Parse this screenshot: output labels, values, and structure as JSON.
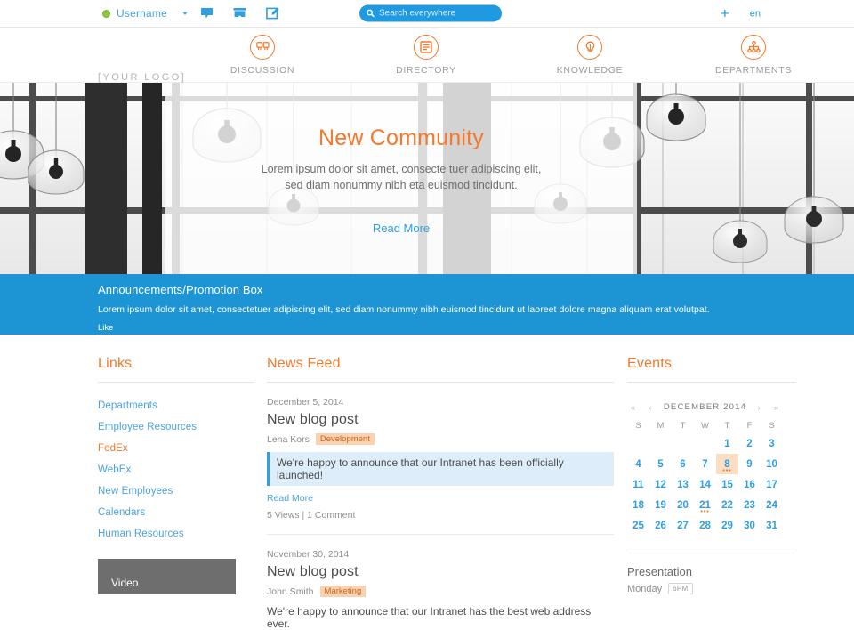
{
  "topbar": {
    "username": "Username",
    "status_icon": "status-dot-online",
    "caret_icon": "chevron-down-icon",
    "icons": [
      "chat-bubble-icon",
      "inbox-icon",
      "compose-icon"
    ],
    "search": {
      "placeholder": "Search everywhere",
      "icon": "search-icon"
    },
    "add_label": "+",
    "language": "en"
  },
  "header": {
    "logo": "[YOUR LOGO]",
    "nav": [
      {
        "label": "DISCUSSION",
        "icon": "discussion-icon"
      },
      {
        "label": "DIRECTORY",
        "icon": "directory-icon"
      },
      {
        "label": "KNOWLEDGE",
        "icon": "lightbulb-icon"
      },
      {
        "label": "DEPARTMENTS",
        "icon": "org-chart-icon"
      }
    ]
  },
  "hero": {
    "title": "New Community",
    "subtitle": "Lorem ipsum dolor sit amet, consecte tuer adipiscing elit, sed diam nonummy nibh eta euismod tincidunt.",
    "link": "Read More"
  },
  "announcement": {
    "title": "Announcements/Promotion Box",
    "body": "Lorem ipsum dolor sit amet, consectetuer adipiscing elit, sed diam nonummy nibh euismod tincidunt ut laoreet dolore magna aliquam erat volutpat.",
    "like": "Like",
    "bg_color": "#1d95d4"
  },
  "links": {
    "title": "Links",
    "items": [
      {
        "label": "Departments",
        "accent": false
      },
      {
        "label": "Employee Resources",
        "accent": false
      },
      {
        "label": "FedEx",
        "accent": true
      },
      {
        "label": "WebEx",
        "accent": false
      },
      {
        "label": "New Employees",
        "accent": false
      },
      {
        "label": "Calendars",
        "accent": false
      },
      {
        "label": "Human Resources",
        "accent": false
      }
    ],
    "video_box": "Video"
  },
  "news_feed": {
    "title": "News Feed",
    "posts": [
      {
        "date": "December 5, 2014",
        "title": "New blog post",
        "author": "Lena Kors",
        "tag": "Development",
        "quote": "We're happy to announce that our Intranet has been officially launched!",
        "read_more": "Read More",
        "stats": "5 Views | 1 Comment"
      },
      {
        "date": "November 30, 2014",
        "title": "New blog post",
        "author": "John Smith",
        "tag": "Marketing",
        "quote": "We're happy to announce that our Intranet has the best web address ever."
      }
    ]
  },
  "events": {
    "title": "Events",
    "calendar": {
      "month_label": "DECEMBER 2014",
      "nav": {
        "first": "«",
        "prev": "‹",
        "next": "›",
        "last": "»"
      },
      "weekdays": [
        "S",
        "M",
        "T",
        "W",
        "T",
        "F",
        "S"
      ],
      "lead_blanks": 4,
      "days": [
        1,
        2,
        3,
        4,
        5,
        6,
        7,
        8,
        9,
        10,
        11,
        12,
        13,
        14,
        15,
        16,
        17,
        18,
        19,
        20,
        21,
        22,
        23,
        24,
        25,
        26,
        27,
        28,
        29,
        30,
        31
      ],
      "today": 8,
      "event_days": [
        8,
        21
      ],
      "day_color": "#2f9fe0",
      "today_bg": "#fbddc2",
      "today_color": "#f4792b"
    },
    "list": [
      {
        "title": "Presentation",
        "day": "Monday",
        "time": "6PM"
      }
    ]
  },
  "theme": {
    "accent": "#f4792b",
    "link": "#4aa3e0",
    "blue": "#1d95d4"
  }
}
